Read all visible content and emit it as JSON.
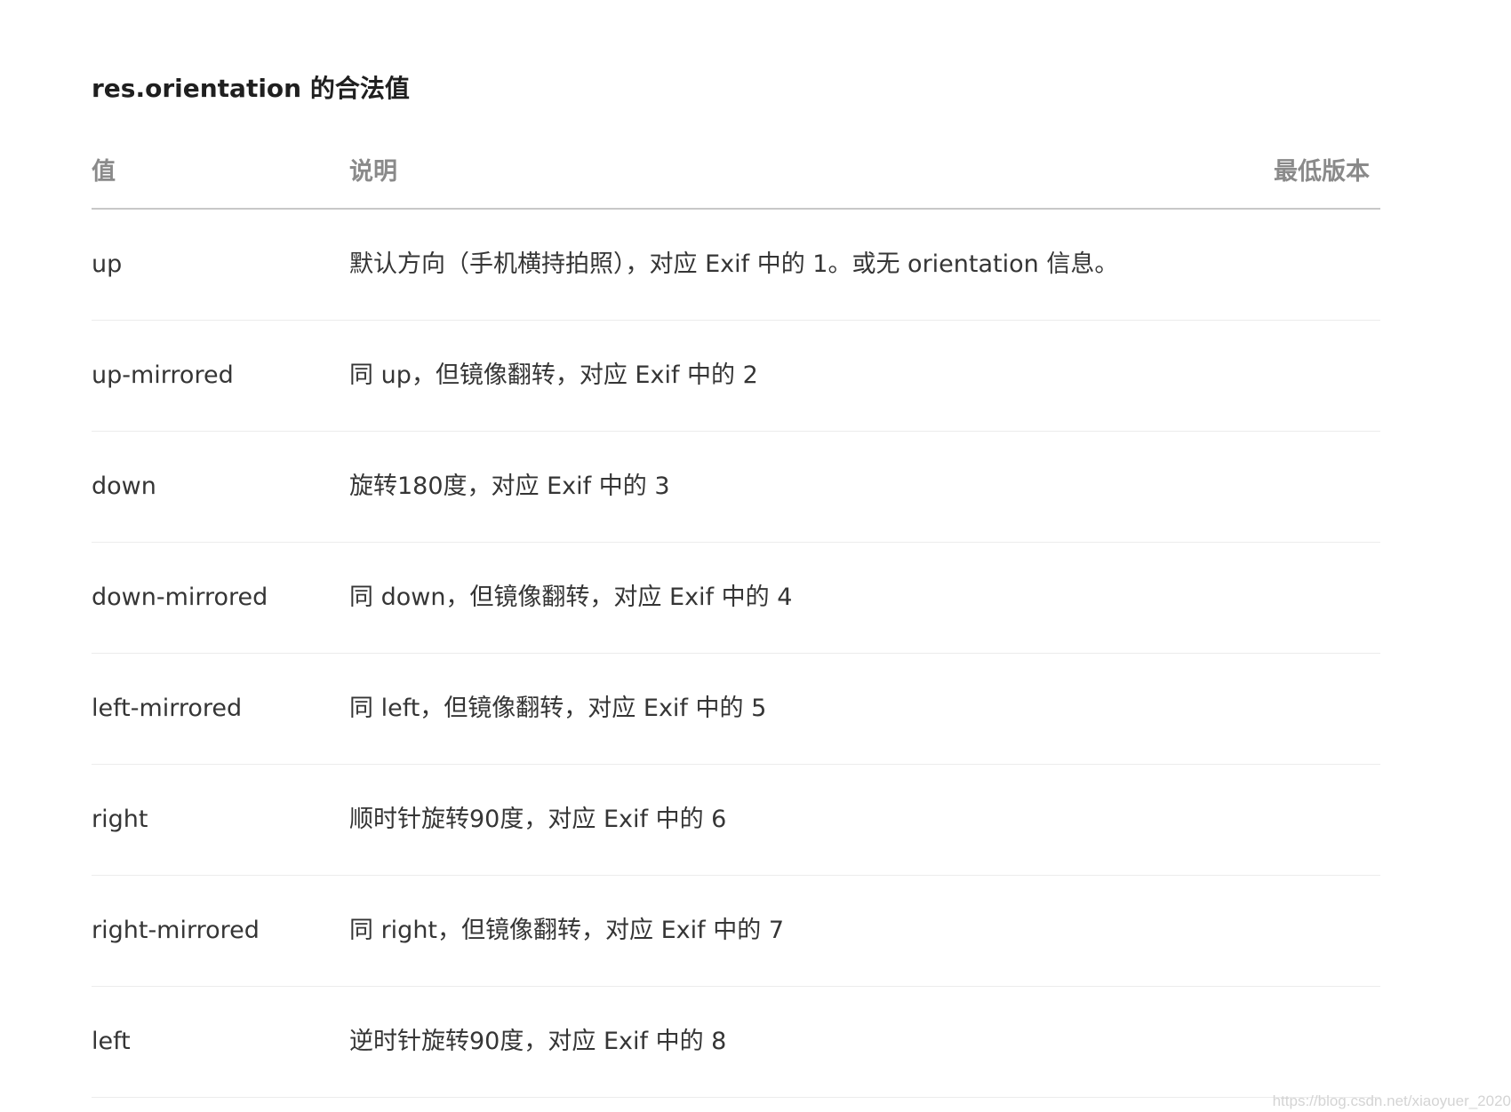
{
  "section": {
    "title": "res.orientation 的合法值"
  },
  "table": {
    "headers": {
      "value": "值",
      "description": "说明",
      "min_version": "最低版本"
    },
    "rows": [
      {
        "value": "up",
        "description": "默认方向（手机横持拍照），对应 Exif 中的 1。或无 orientation 信息。",
        "min_version": ""
      },
      {
        "value": "up-mirrored",
        "description": "同 up，但镜像翻转，对应 Exif 中的 2",
        "min_version": ""
      },
      {
        "value": "down",
        "description": "旋转180度，对应 Exif 中的 3",
        "min_version": ""
      },
      {
        "value": "down-mirrored",
        "description": "同 down，但镜像翻转，对应 Exif 中的 4",
        "min_version": ""
      },
      {
        "value": "left-mirrored",
        "description": "同 left，但镜像翻转，对应 Exif 中的 5",
        "min_version": ""
      },
      {
        "value": "right",
        "description": "顺时针旋转90度，对应 Exif 中的 6",
        "min_version": ""
      },
      {
        "value": "right-mirrored",
        "description": "同 right，但镜像翻转，对应 Exif 中的 7",
        "min_version": ""
      },
      {
        "value": "left",
        "description": "逆时针旋转90度，对应 Exif 中的 8",
        "min_version": ""
      }
    ]
  },
  "watermark": "https://blog.csdn.net/xiaoyuer_2020"
}
